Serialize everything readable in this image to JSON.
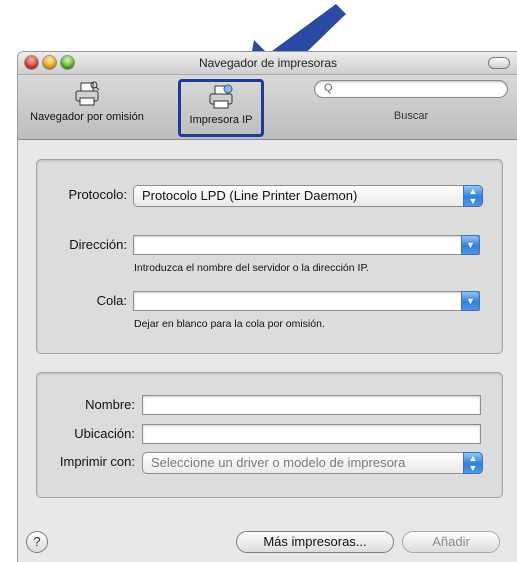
{
  "window": {
    "title": "Navegador de impresoras"
  },
  "toolbar": {
    "default_browser_label": "Navegador por omisión",
    "ip_printer_label": "Impresora IP",
    "search_placeholder": "Q",
    "search_label": "Buscar"
  },
  "form": {
    "protocol_label": "Protocolo:",
    "protocol_value": "Protocolo LPD (Line Printer Daemon)",
    "address_label": "Dirección:",
    "address_value": "",
    "address_hint": "Introduzca el nombre del servidor o la dirección IP.",
    "queue_label": "Cola:",
    "queue_value": "",
    "queue_hint": "Dejar en blanco para la cola por omisión.",
    "name_label": "Nombre:",
    "name_value": "",
    "location_label": "Ubicación:",
    "location_value": "",
    "print_with_label": "Imprimir con:",
    "print_with_value": "Seleccione un driver o modelo de impresora"
  },
  "footer": {
    "help_label": "?",
    "more_printers_label": "Más impresoras...",
    "add_label": "Añadir"
  },
  "colors": {
    "highlight_border": "#1f3b9a",
    "arrow": "#2a4aa3",
    "accent_blue": "#2f7fe0"
  }
}
